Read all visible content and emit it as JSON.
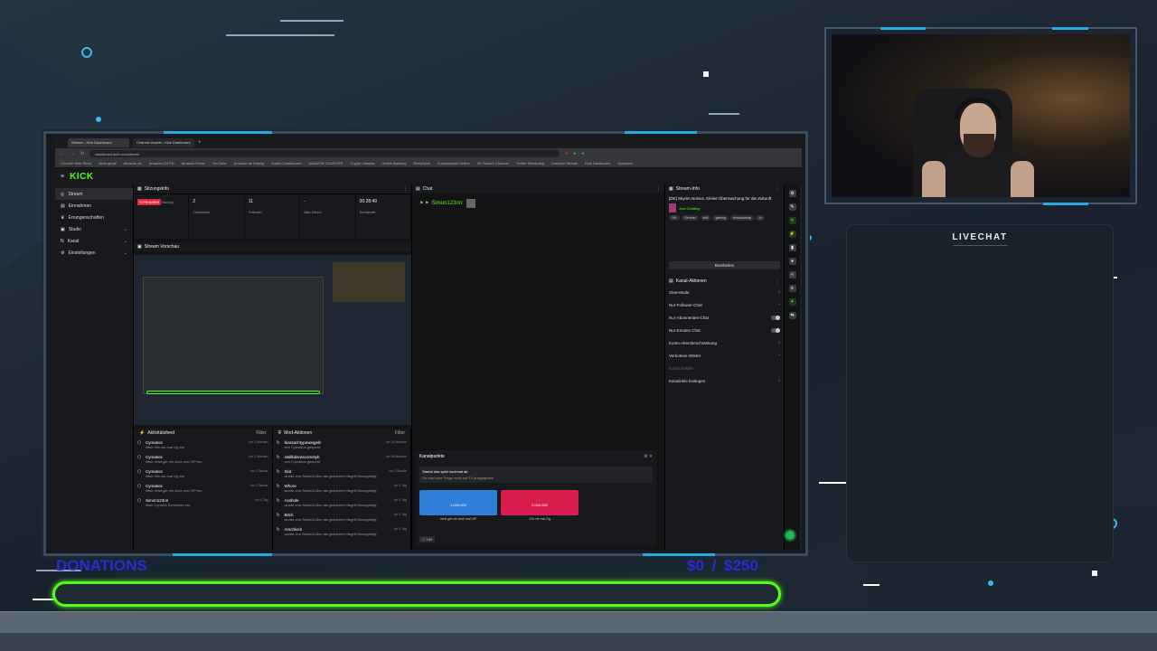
{
  "browser": {
    "tabs": [
      "Stream - Kick Dashboard",
      "Channel Assets - Kick Dashboard"
    ],
    "url": "dashboard.kick.com/stream",
    "bookmarks": [
      "Chrome Web Store",
      "Mein gmail",
      "Amazon.de",
      "Amazon.CH Fix",
      "Amazon Prime",
      "YouTube",
      "Amazon.de Einstig",
      "Kaufen Dashboard",
      "AMAZON COUNTER",
      "Crypto / Assets",
      "Online Banking",
      "DeepSeek",
      "Komponente-Online",
      "3D Stream Channel",
      "Twitter Streaming",
      "Löschen Stream",
      "Kick Dashboard",
      "Spielplan"
    ]
  },
  "kick": {
    "logo": "KICK",
    "sidebar": [
      {
        "label": "Stream",
        "icon": "stream-icon",
        "active": true
      },
      {
        "label": "Einnahmen",
        "icon": "money-icon"
      },
      {
        "label": "Errungenschaften",
        "icon": "trophy-icon"
      },
      {
        "label": "Studio",
        "icon": "studio-icon",
        "expand": true
      },
      {
        "label": "Kanal",
        "icon": "channel-icon",
        "expand": true
      },
      {
        "label": "Einstellungen",
        "icon": "gear-icon",
        "expand": true
      }
    ],
    "sitzungsinfo": {
      "title": "Sitzungsinfo",
      "badge": "STREAMER",
      "stats": [
        {
          "value": "",
          "label": "Sitzung"
        },
        {
          "value": "2",
          "label": "Zuschauer"
        },
        {
          "value": "11",
          "label": "Follower"
        },
        {
          "value": "-",
          "label": "Abo-Zähler"
        },
        {
          "value": "00:28:49",
          "label": "Sendezeit"
        }
      ]
    },
    "preview_title": "Stream Vorschau",
    "activity": {
      "title": "Aktivitätsfeed",
      "filter": "Filter",
      "items": [
        {
          "name": "Cymakos",
          "text": "löste Gib mir mal Og ein.",
          "time": "vor 1 Minuten"
        },
        {
          "name": "Cymakos",
          "text": "löste Jetzt gib mir doch mal VIP ein.",
          "time": "vor 2 Minuten"
        },
        {
          "name": "Cymakos",
          "text": "löste Gib mir mal Og ein.",
          "time": "vor 1 Stunde"
        },
        {
          "name": "Cymakos",
          "text": "löste Jetzt gib mir doch mal VIP ein.",
          "time": "vor 1 Stunde"
        },
        {
          "name": "Simon123nn",
          "text": "löste Cymel's Schreiben ein.",
          "time": "vor 1 Tag"
        }
      ]
    },
    "mod": {
      "title": "Mod-Aktionen",
      "filter": "Filter",
      "items": [
        {
          "name": "fearsachtypewingelv",
          "text": "von Cymakos gesperrt",
          "time": "vor 24 Minuten"
        },
        {
          "name": "stallkidsrascomstyb",
          "text": "von Cymakos gesperrt",
          "time": "vor 59 Minuten"
        },
        {
          "name": "Slut",
          "text": "wurde von Simon123nn als gesperrter Begriff hinzugefügt",
          "time": "vor 1 Stunde"
        },
        {
          "name": "Whore",
          "text": "wurde von Simon123nn als gesperrter Begriff hinzugefügt",
          "time": "vor 1 Tag"
        },
        {
          "name": "Asshole",
          "text": "wurde von Simon123nn als gesperrter Begriff hinzugefügt",
          "time": "vor 1 Tag"
        },
        {
          "name": "Bitch",
          "text": "wurde von Simon123nn als gesperrter Begriff hinzugefügt",
          "time": "vor 1 Tag"
        },
        {
          "name": "Arschloch",
          "text": "wurde von Simon123nn als gesperrter Begriff hinzugefügt",
          "time": "vor 1 Tag"
        }
      ]
    },
    "chat": {
      "title": "Chat",
      "message_user": "Simon123nn:"
    },
    "kanalpunkte": {
      "title": "Kanalpunkte",
      "prompt": "Startet das spiel nochmal ab",
      "sub": "Du hast eine Frage noch auf 10 ausgegeben",
      "reward1": {
        "cost": "1.000.000",
        "label": "Jetzt gib mir doch mal VIP",
        "color": "#2f7fd8"
      },
      "reward2": {
        "cost": "2.000.000",
        "label": "Gib mir mal Og",
        "color": "#d81e4e"
      },
      "balance": "100"
    },
    "streaminfo": {
      "title": "Stream-Info",
      "stream_title": "[DE] Skyrim Nolvus. Kleine Überraschung für die Zukunft",
      "category": "Just Chatting",
      "tags": [
        "18+",
        "German",
        "skill",
        "gaming",
        "tomorrowday",
        "Zz"
      ],
      "edit": "Bearbeiten"
    },
    "kanalaktionen": {
      "title": "Kanal-Aktionen",
      "items": [
        {
          "label": "Slow-Mode",
          "control": "chevron"
        },
        {
          "label": "Nur-Follower-Chat",
          "control": "chevron"
        },
        {
          "label": "Nur-Abonnenten-Chat",
          "control": "toggle"
        },
        {
          "label": "Nur-Emotes Chat",
          "control": "toggle"
        },
        {
          "label": "Konto-Altersbeschränkung",
          "control": "chevron"
        },
        {
          "label": "Verbotene Wörter",
          "control": "chevron"
        },
        {
          "label": "Kanal melden",
          "control": "none"
        },
        {
          "label": "Kanalziele festlegen",
          "control": "chevron"
        }
      ]
    }
  },
  "overlay": {
    "livechat_title": "LIVECHAT",
    "donations_label": "DONATIONS",
    "donations_amount": "$0  / $250",
    "donations_progress": 0
  }
}
